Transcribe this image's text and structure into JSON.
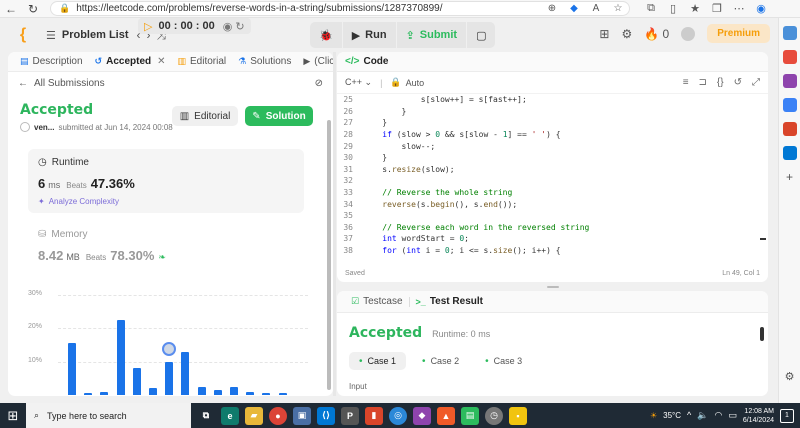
{
  "browser": {
    "url": "https://leetcode.com/problems/reverse-words-in-a-string/submissions/1287370899/"
  },
  "nav": {
    "problem_list": "Problem List",
    "timer": "00 : 00 : 00",
    "run": "Run",
    "submit": "Submit",
    "fire_count": "0",
    "premium": "Premium"
  },
  "left_tabs": [
    {
      "label": "Description"
    },
    {
      "label": "Accepted"
    },
    {
      "label": "Editorial"
    },
    {
      "label": "Solutions"
    },
    {
      "label": "(Click)"
    }
  ],
  "submission": {
    "all_submissions": "All Submissions",
    "status": "Accepted",
    "user": "ven...",
    "submitted_at": "submitted at Jun 14, 2024 00:08",
    "editorial_btn": "Editorial",
    "solution_btn": "Solution"
  },
  "runtime": {
    "label": "Runtime",
    "value": "6",
    "unit": "ms",
    "beats_label": "Beats",
    "beats": "47.36%",
    "analyze": "Analyze Complexity"
  },
  "memory": {
    "label": "Memory",
    "value": "8.42",
    "unit": "MB",
    "beats_label": "Beats",
    "beats": "78.30%"
  },
  "chart_data": {
    "type": "bar",
    "yticks": [
      "30%",
      "20%",
      "10%"
    ],
    "ylim": [
      0,
      30
    ],
    "values": [
      15.5,
      0.5,
      1,
      22.5,
      8,
      2,
      10,
      13,
      2.5,
      1.5,
      2.5,
      1,
      0.5,
      0.5
    ],
    "highlight_index": 6,
    "color": "#1a73e8"
  },
  "code_panel": {
    "title": "Code",
    "language": "C++",
    "mode": "Auto",
    "status_left": "Saved",
    "status_right": "Ln 49, Col 1"
  },
  "code_lines": [
    {
      "n": "25",
      "html": "            s[slow++] = s[fast++];"
    },
    {
      "n": "26",
      "html": "        }"
    },
    {
      "n": "27",
      "html": "    }"
    },
    {
      "n": "28",
      "html": "    if (slow > 0 && s[slow - 1] == ' ') {"
    },
    {
      "n": "29",
      "html": "        slow--;"
    },
    {
      "n": "30",
      "html": "    }"
    },
    {
      "n": "31",
      "html": "    s.resize(slow);"
    },
    {
      "n": "32",
      "html": ""
    },
    {
      "n": "33",
      "html": "    // Reverse the whole string"
    },
    {
      "n": "34",
      "html": "    reverse(s.begin(), s.end());"
    },
    {
      "n": "35",
      "html": ""
    },
    {
      "n": "36",
      "html": "    // Reverse each word in the reversed string"
    },
    {
      "n": "37",
      "html": "    int wordStart = 0;"
    },
    {
      "n": "38",
      "html": "    for (int i = 0; i <= s.size(); i++) {"
    }
  ],
  "bottom_panel": {
    "tab_testcase": "Testcase",
    "tab_result": "Test Result",
    "result": "Accepted",
    "runtime": "Runtime: 0 ms",
    "cases": [
      "Case 1",
      "Case 2",
      "Case 3"
    ],
    "input_label": "Input"
  },
  "taskbar": {
    "search": "Type here to search",
    "temperature": "35°C",
    "time": "12:08 AM",
    "date": "6/14/2024"
  }
}
